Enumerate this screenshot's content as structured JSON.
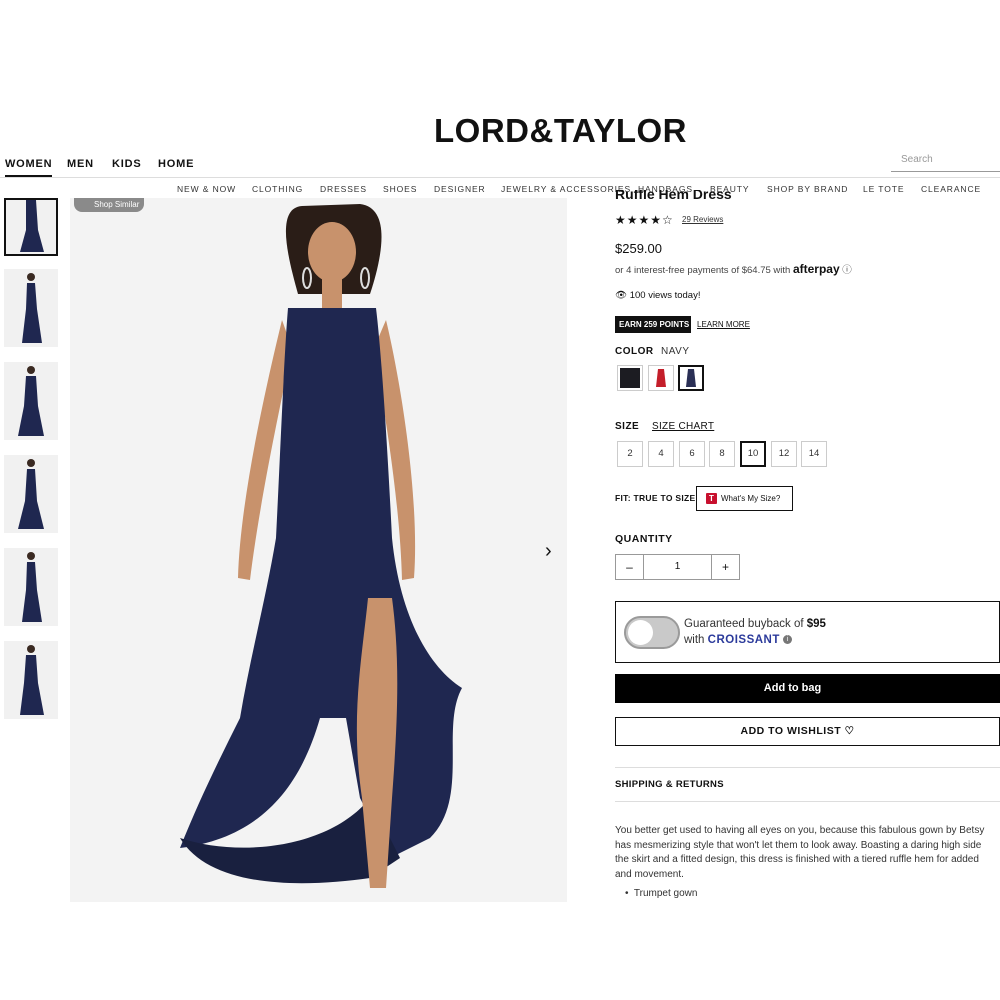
{
  "header": {
    "logo": "LORD&TAYLOR",
    "main_nav": [
      "WOMEN",
      "MEN",
      "KIDS",
      "HOME"
    ],
    "search_placeholder": "Search",
    "sub_nav": [
      "NEW & NOW",
      "CLOTHING",
      "DRESSES",
      "SHOES",
      "DESIGNER",
      "JEWELRY & ACCESSORIES",
      "HANDBAGS",
      "BEAUTY",
      "SHOP BY BRAND",
      "LE TOTE",
      "CLEARANCE"
    ]
  },
  "gallery": {
    "shop_similar": "Shop Similar",
    "thumbnail_count": 6,
    "next_icon": "chevron-right-icon"
  },
  "product": {
    "title": "Ruffle Hem Dress",
    "rating": 4,
    "reviews": "29 Reviews",
    "price": "$259.00",
    "installment": "or 4 interest-free payments of $64.75 with",
    "afterpay": "afterpay",
    "views": "100 views today!",
    "points": "EARN 259 POINTS",
    "learn_more": "LEARN MORE",
    "color_label": "COLOR",
    "color_value": "NAVY",
    "swatch_colors": [
      "#1c1c22",
      "#c41e2a",
      "#2a2f55"
    ],
    "size_label": "SIZE",
    "size_chart": "SIZE CHART",
    "sizes": [
      "2",
      "4",
      "6",
      "8",
      "10",
      "12",
      "14"
    ],
    "selected_size": "10",
    "fit": "FIT: TRUE TO SIZE",
    "whats_my_size": "What's My Size?",
    "quantity_label": "QUANTITY",
    "quantity": "1",
    "buyback_text": "Guaranteed buyback of",
    "buyback_amount": "$95",
    "buyback_with": "with",
    "croissant": "CROISSANT",
    "add_to_bag": "Add to bag",
    "add_to_wishlist": "ADD TO WISHLIST",
    "shipping": "SHIPPING & RETURNS",
    "description": [
      "You better get used to having all eyes on you, because this fabulous gown by Betsy",
      "has mesmerizing style that won't let them to look away. Boasting a daring high side",
      "the skirt and a fitted design, this dress is finished with a tiered ruffle hem for added",
      "and movement."
    ],
    "bullet": "Trumpet gown"
  },
  "colors": {
    "dress_navy": "#1f2750",
    "skin": "#c8926c",
    "accent_black": "#000000"
  }
}
